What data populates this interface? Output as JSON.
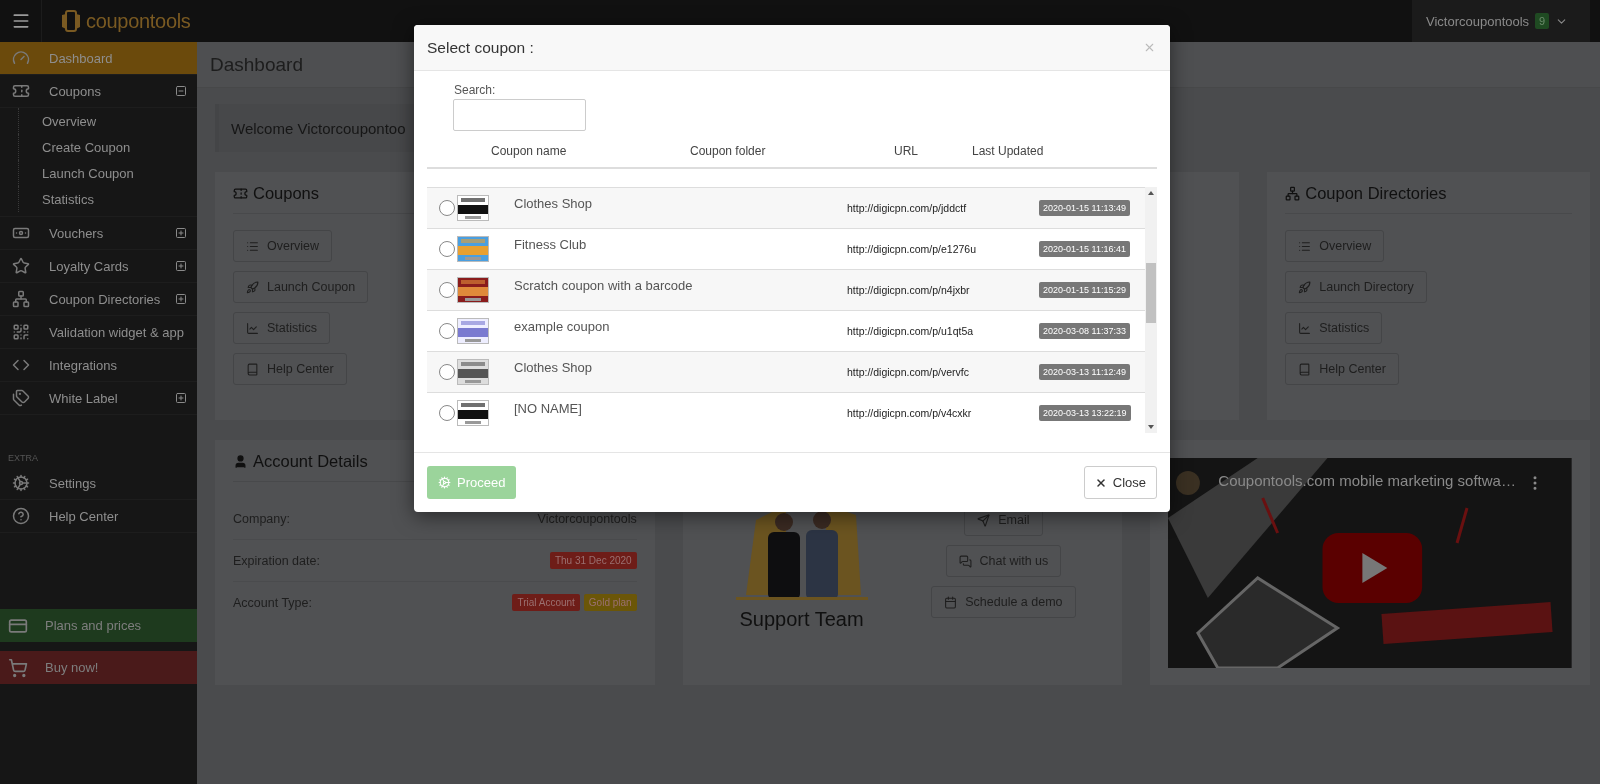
{
  "topbar": {
    "brand": "coupontools",
    "user": "Victorcoupontools",
    "notifications": "9"
  },
  "sidebar": {
    "items": [
      {
        "label": "Dashboard",
        "selected": true
      },
      {
        "label": "Coupons",
        "selected": false,
        "expanded": true,
        "children": [
          {
            "label": "Overview"
          },
          {
            "label": "Create Coupon"
          },
          {
            "label": "Launch Coupon"
          },
          {
            "label": "Statistics"
          }
        ]
      },
      {
        "label": "Vouchers",
        "selected": false,
        "expanded": false
      },
      {
        "label": "Loyalty Cards",
        "selected": false,
        "expanded": false
      },
      {
        "label": "Coupon Directories",
        "selected": false,
        "expanded": false
      },
      {
        "label": "Validation widget & app",
        "selected": false
      },
      {
        "label": "Integrations",
        "selected": false
      },
      {
        "label": "White Label",
        "selected": false,
        "expanded": false
      }
    ],
    "section": "EXTRA",
    "extra_items": [
      {
        "label": "Settings",
        "selected": false
      },
      {
        "label": "Help Center",
        "selected": false
      }
    ],
    "promos": [
      {
        "label": "Plans and prices",
        "color": "#1e3a1e"
      },
      {
        "label": "Buy now!",
        "color": "#4a1a1a"
      }
    ]
  },
  "page": {
    "title": "Dashboard",
    "welcome": "Welcome Victorcoupontoo"
  },
  "coupons_card": {
    "title": "Coupons",
    "buttons": [
      "Overview",
      "Launch Coupon",
      "Statistics",
      "Help Center"
    ]
  },
  "directories_card": {
    "title": "Coupon Directories",
    "buttons": [
      "Overview",
      "Launch Directory",
      "Statistics",
      "Help Center"
    ]
  },
  "account": {
    "title": "Account Details",
    "rows": [
      {
        "label": "Company:",
        "value": "Victorcoupontools"
      },
      {
        "label": "Expiration date:",
        "badges": [
          {
            "text": "Thu 31 Dec 2020",
            "color": "#6e1d18"
          }
        ]
      },
      {
        "label": "Account Type:",
        "badges": [
          {
            "text": "Trial Account",
            "color": "#6e1d18"
          },
          {
            "text": "Gold plan",
            "color": "#6b5608"
          }
        ]
      }
    ]
  },
  "support": {
    "caption": "Support Team",
    "buttons": [
      "Email",
      "Chat with us",
      "Schedule a demo"
    ]
  },
  "video": {
    "title": "Coupontools.com mobile marketing softwa…"
  },
  "modal": {
    "title": "Select coupon :",
    "search": {
      "label": "Search:"
    },
    "columns": [
      "Coupon name",
      "Coupon folder",
      "URL",
      "Last Updated"
    ],
    "rows": [
      {
        "name": "Clothes Shop",
        "url": "http://digicpn.com/p/jddctf",
        "updated": "2020-01-15 11:13:49",
        "selected": false
      },
      {
        "name": "Fitness Club",
        "url": "http://digicpn.com/p/e1276u",
        "updated": "2020-01-15 11:16:41",
        "selected": false
      },
      {
        "name": "Scratch coupon with a barcode",
        "url": "http://digicpn.com/p/n4jxbr",
        "updated": "2020-01-15 11:15:29",
        "selected": false
      },
      {
        "name": "example coupon",
        "url": "http://digicpn.com/p/u1qt5a",
        "updated": "2020-03-08 11:37:33",
        "selected": false
      },
      {
        "name": "Clothes Shop",
        "url": "http://digicpn.com/p/vervfc",
        "updated": "2020-03-13 11:12:49",
        "selected": false
      },
      {
        "name": "[NO NAME]",
        "url": "http://digicpn.com/p/v4cxkr",
        "updated": "2020-03-13 13:22:19",
        "selected": false
      }
    ],
    "proceed": {
      "label": "Proceed",
      "disabled": true
    },
    "close": "Close"
  }
}
